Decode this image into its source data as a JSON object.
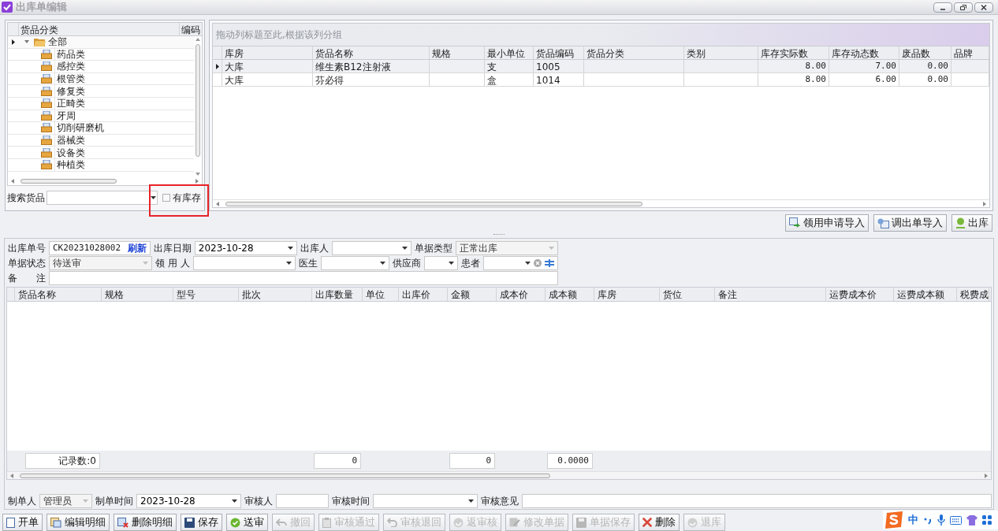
{
  "window": {
    "title": "出库单编辑"
  },
  "category_tree": {
    "columns": [
      "货品分类",
      "编码"
    ],
    "nodes": [
      {
        "label": "全部",
        "expanded": true,
        "selected": true,
        "children": [
          {
            "label": "药品类"
          },
          {
            "label": "感控类"
          },
          {
            "label": "根管类"
          },
          {
            "label": "修复类"
          },
          {
            "label": "正畸类"
          },
          {
            "label": "牙周"
          },
          {
            "label": "切削研磨机"
          },
          {
            "label": "器械类"
          },
          {
            "label": "设备类"
          },
          {
            "label": "种植类"
          }
        ]
      }
    ]
  },
  "search": {
    "label": "搜索货品",
    "stock_filter": {
      "label": "有库存",
      "checked": false
    }
  },
  "stock_grid": {
    "group_hint": "拖动列标题至此,根据该列分组",
    "columns": [
      "库房",
      "货品名称",
      "规格",
      "最小单位",
      "货品编码",
      "货品分类",
      "类别",
      "库存实际数",
      "库存动态数",
      "废品数",
      "品牌"
    ],
    "rows": [
      {
        "selected": true,
        "cells": [
          "大库",
          "维生素B12注射液",
          "",
          "支",
          "1005",
          "",
          "",
          "8.00",
          "7.00",
          "0.00",
          ""
        ]
      },
      {
        "selected": false,
        "cells": [
          "大库",
          "芬必得",
          "",
          "盒",
          "1014",
          "",
          "",
          "8.00",
          "6.00",
          "0.00",
          ""
        ]
      }
    ]
  },
  "import_buttons": [
    "领用申请导入",
    "调出单导入",
    "出库"
  ],
  "form_rows": [
    [
      {
        "label": "出库单号",
        "kind": "text",
        "value": "CK20231028002",
        "link": "刷新"
      },
      {
        "label": "出库日期",
        "kind": "combo",
        "value": "2023-10-28",
        "disabled": false
      },
      {
        "label": "出库人",
        "kind": "combo",
        "disabled": false
      },
      {
        "label": "单据类型",
        "kind": "combo",
        "value": "正常出库",
        "disabled": true
      }
    ],
    [
      {
        "label": "单据状态",
        "kind": "combo",
        "value": "待送审",
        "disabled": true
      },
      {
        "label": "领 用 人",
        "kind": "combo",
        "disabled": false
      },
      {
        "label": "医生",
        "kind": "combo",
        "disabled": false
      },
      {
        "label": "供应商",
        "kind": "combo",
        "disabled": false
      },
      {
        "label": "患者",
        "kind": "picker",
        "disabled": false
      }
    ],
    [
      {
        "label": "备　　注",
        "kind": "memo"
      }
    ]
  ],
  "detail_grid": {
    "columns": [
      "货品名称",
      "规格",
      "型号",
      "批次",
      "出库数量",
      "单位",
      "出库价",
      "金额",
      "成本价",
      "成本额",
      "库房",
      "货位",
      "备注",
      "运费成本价",
      "运费成本额",
      "税费成"
    ],
    "summary": [
      "记录数:0",
      "0",
      "0",
      "0.0000"
    ]
  },
  "audit_fields": [
    {
      "label": "制单人",
      "kind": "combo",
      "value": "管理员",
      "disabled": true
    },
    {
      "label": "制单时间",
      "kind": "combo",
      "value": "2023-10-28",
      "disabled": false
    },
    {
      "label": "审核人",
      "kind": "text"
    },
    {
      "label": "审核时间",
      "kind": "combo",
      "disabled": false
    },
    {
      "label": "审核意见",
      "kind": "memo"
    }
  ],
  "toolbar": [
    {
      "label": "开单",
      "disabled": false
    },
    {
      "label": "编辑明细",
      "disabled": false
    },
    {
      "label": "删除明细",
      "disabled": false
    },
    {
      "label": "保存",
      "disabled": false
    },
    {
      "label": "送审",
      "disabled": false
    },
    {
      "label": "撤回",
      "disabled": true
    },
    {
      "label": "审核通过",
      "disabled": true
    },
    {
      "label": "审核退回",
      "disabled": true
    },
    {
      "label": "返审核",
      "disabled": true
    },
    {
      "label": "修改单据",
      "disabled": true
    },
    {
      "label": "单据保存",
      "disabled": true
    },
    {
      "label": "删除",
      "disabled": false
    },
    {
      "label": "退库",
      "disabled": true
    }
  ],
  "ime": {
    "label": "中"
  }
}
